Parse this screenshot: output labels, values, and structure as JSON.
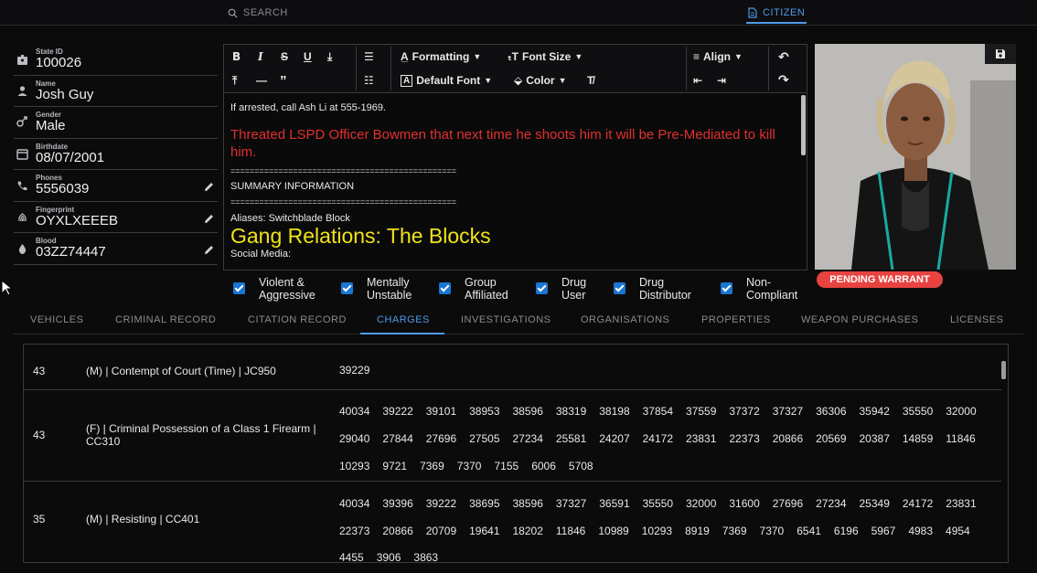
{
  "topnav": {
    "search": "SEARCH",
    "citizen": "CITIZEN"
  },
  "profile": {
    "fields": [
      {
        "label": "State ID",
        "value": "100026",
        "icon": "id-badge-icon",
        "editable": false
      },
      {
        "label": "Name",
        "value": "Josh Guy",
        "icon": "person-icon",
        "editable": false
      },
      {
        "label": "Gender",
        "value": "Male",
        "icon": "gender-icon",
        "editable": false
      },
      {
        "label": "Birthdate",
        "value": "08/07/2001",
        "icon": "calendar-icon",
        "editable": false
      },
      {
        "label": "Phones",
        "value": "5556039",
        "icon": "phone-icon",
        "editable": true
      },
      {
        "label": "Fingerprint",
        "value": "OYXLXEEEB",
        "icon": "fingerprint-icon",
        "editable": true
      },
      {
        "label": "Blood",
        "value": "03ZZ74447",
        "icon": "blood-drop-icon",
        "editable": true
      }
    ]
  },
  "toolbar": {
    "formatting": "Formatting",
    "font_size": "Font Size",
    "default_font": "Default Font",
    "color": "Color",
    "align": "Align"
  },
  "editor": {
    "line1": "If arrested, call Ash Li at 555-1969.",
    "red_note": "Threated LSPD Officer Bowmen that next time he shoots him it will be Pre-Mediated to kill him.",
    "separator": "===============================================",
    "summary": "SUMMARY INFORMATION",
    "aliases": "Aliases: Switchblade Block",
    "gang": "Gang Relations: The Blocks",
    "social": "Social Media:"
  },
  "warrant": "PENDING WARRANT",
  "flags": [
    {
      "label": "Violent &\nAggressive",
      "checked": true
    },
    {
      "label": "Mentally\nUnstable",
      "checked": true
    },
    {
      "label": "Group\nAffiliated",
      "checked": true
    },
    {
      "label": "Drug\nUser",
      "checked": true
    },
    {
      "label": "Drug\nDistributor",
      "checked": true
    },
    {
      "label": "Non-\nCompliant",
      "checked": true
    }
  ],
  "tabs": [
    "VEHICLES",
    "CRIMINAL RECORD",
    "CITATION RECORD",
    "CHARGES",
    "INVESTIGATIONS",
    "ORGANISATIONS",
    "PROPERTIES",
    "WEAPON PURCHASES",
    "LICENSES"
  ],
  "active_tab": "CHARGES",
  "charges": [
    {
      "count": "43",
      "name": "(M) | Contempt of Court (Time) | JC950",
      "ids": [
        "39229"
      ]
    },
    {
      "count": "43",
      "name": "(F) | Criminal Possession of a Class 1 Firearm | CC310",
      "ids": [
        "40034",
        "39222",
        "39101",
        "38953",
        "38596",
        "38319",
        "38198",
        "37854",
        "37559",
        "37372",
        "37327",
        "36306",
        "35942",
        "35550",
        "32000",
        "29040",
        "27844",
        "27696",
        "27505",
        "27234",
        "25581",
        "24207",
        "24172",
        "23831",
        "22373",
        "20866",
        "20569",
        "20387",
        "14859",
        "11846",
        "10293",
        "9721",
        "7369",
        "7370",
        "7155",
        "6006",
        "5708"
      ]
    },
    {
      "count": "35",
      "name": "(M) | Resisting | CC401",
      "ids": [
        "40034",
        "39396",
        "39222",
        "38695",
        "38596",
        "37327",
        "36591",
        "35550",
        "32000",
        "31600",
        "27696",
        "27234",
        "25349",
        "24172",
        "23831",
        "22373",
        "20866",
        "20709",
        "19641",
        "18202",
        "11846",
        "10989",
        "10293",
        "8919",
        "7369",
        "7370",
        "6541",
        "6196",
        "5967",
        "4983",
        "4954",
        "4455",
        "3906",
        "3863"
      ]
    }
  ],
  "colors": {
    "accent": "#4f9be8",
    "checkbox": "#1976d2",
    "warrant": "#e84340",
    "red_text": "#e0302e",
    "yellow_text": "#f1e21a"
  }
}
